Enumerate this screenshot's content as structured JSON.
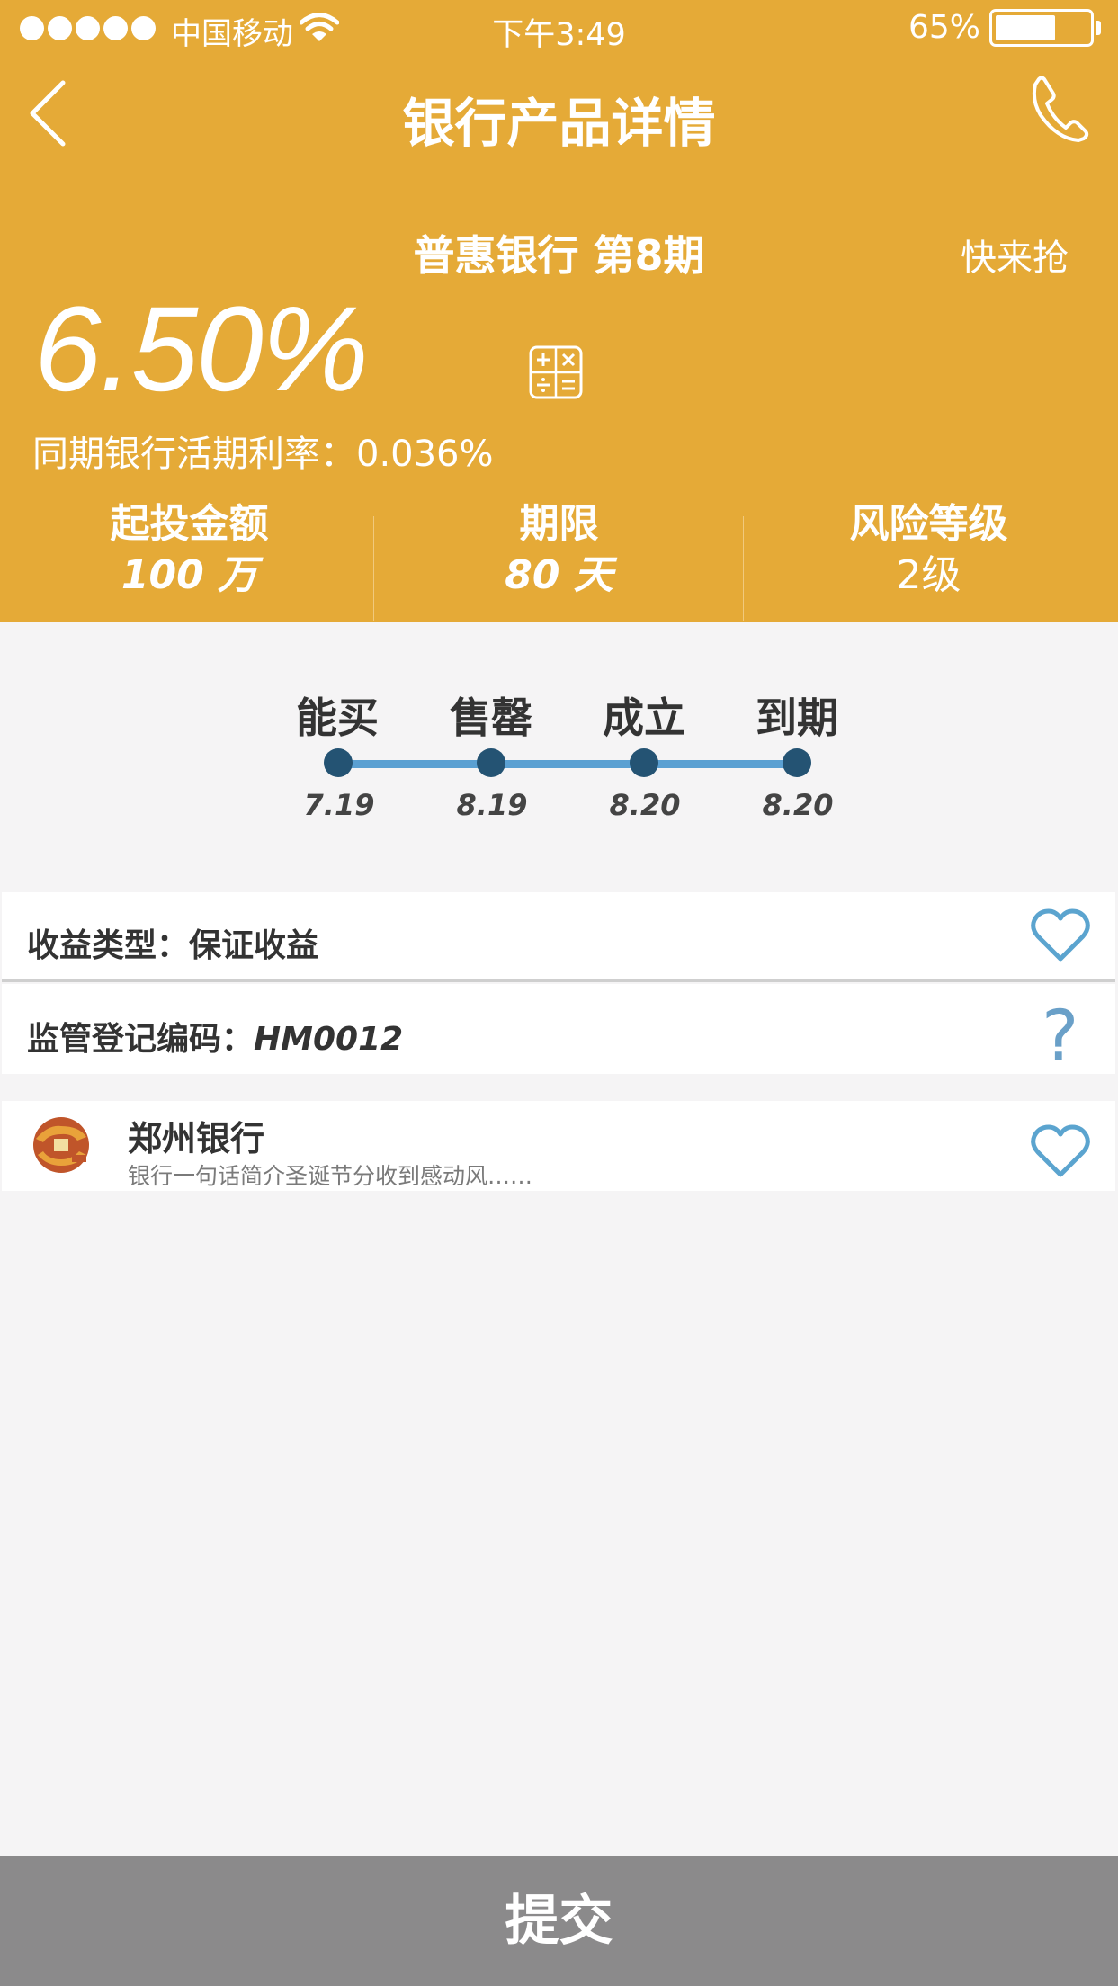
{
  "status_bar": {
    "carrier": "中国移动",
    "time": "下午3:49",
    "battery": "65%",
    "battery_level": 0.65,
    "signal_dots": 5
  },
  "nav": {
    "title": "银行产品详情",
    "back_icon": "chevron-left-icon",
    "phone_icon": "phone-icon"
  },
  "product": {
    "name": "普惠银行 第8期",
    "promo": "快来抢",
    "rate": "6.50%",
    "calculator_icon": "calculator-icon",
    "demand_rate": "同期银行活期利率：0.036%"
  },
  "stats": [
    {
      "label": "起投金额",
      "value": "100 万"
    },
    {
      "label": "期限",
      "value": "80 天"
    },
    {
      "label": "风险等级",
      "value": "2级"
    }
  ],
  "timeline": [
    {
      "label": "能买",
      "date": "7.19"
    },
    {
      "label": "售罄",
      "date": "8.19"
    },
    {
      "label": "成立",
      "date": "8.20"
    },
    {
      "label": "到期",
      "date": "8.20"
    }
  ],
  "details": {
    "yield_type": "收益类型：保证收益",
    "reg_label": "监管登记编码：",
    "reg_code": "HM0012"
  },
  "bank": {
    "name": "郑州银行",
    "description": "银行一句话简介圣诞节分收到感动风……"
  },
  "submit_label": "提交",
  "colors": {
    "header": "#e5aa37",
    "accent_blue": "#5ba0d2",
    "dot_dark": "#245373",
    "submit_bg": "#8b8a8b"
  }
}
